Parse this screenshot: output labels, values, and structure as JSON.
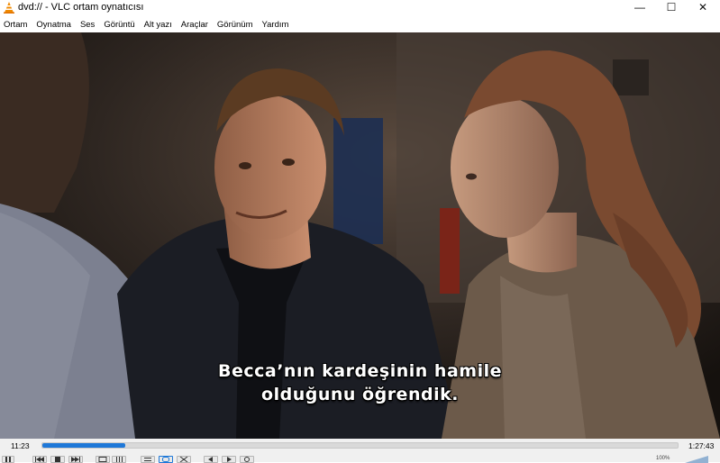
{
  "window": {
    "title": "dvd:// - VLC ortam oynatıcısı",
    "minimize_glyph": "—",
    "maximize_glyph": "☐",
    "close_glyph": "✕"
  },
  "menu": {
    "items": [
      "Ortam",
      "Oynatma",
      "Ses",
      "Görüntü",
      "Alt yazı",
      "Araçlar",
      "Görünüm",
      "Yardım"
    ]
  },
  "video": {
    "subtitle_line1": "Becca’nın kardeşinin hamile",
    "subtitle_line2": "olduğunu öğrendik."
  },
  "playback": {
    "elapsed": "11:23",
    "total": "1:27:43",
    "progress_fraction": 0.13,
    "volume": "100%"
  },
  "colors": {
    "accent": "#1e78d8",
    "vlc_orange": "#f08a00"
  }
}
